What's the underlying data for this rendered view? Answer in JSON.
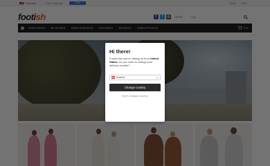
{
  "topbar": {
    "country_label": "Changer",
    "top_text": "Free shipping",
    "badge_label": "Sale",
    "links": [
      "Help",
      "FAQ"
    ]
  },
  "header": {
    "logo_main": "footi",
    "logo_accent": "sh",
    "share_label": "Share",
    "login_label": "Log"
  },
  "nav": {
    "items": [
      "SNEAKERS",
      "BLOUSES",
      "SWEATSHIRTS",
      "HOODIES",
      "SHORTS",
      "SWEATPANTS"
    ],
    "cart_label": "0 €"
  },
  "modal": {
    "title": "Hi there!",
    "text_before": "It looks like you're visiting us from",
    "country_bold": "United States.",
    "text_after": "Do you want to change your delivery country?",
    "selected_country": "Austria",
    "primary_button": "Change country",
    "secondary_link": "Don't change country"
  },
  "colors": {
    "overlay": "#000000",
    "primary_button_bg": "#2b2b2b",
    "logo_accent": "#e8542c",
    "navbar_bg": "#1f1f1f"
  }
}
